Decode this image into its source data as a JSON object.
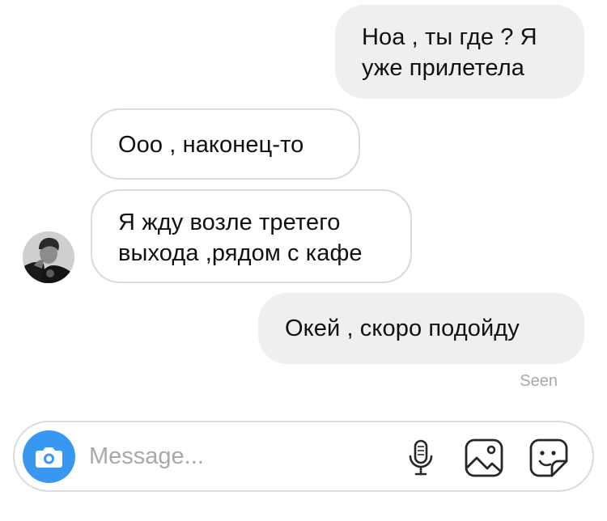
{
  "messages": [
    {
      "id": "msg1",
      "direction": "outgoing",
      "text": "Ноа , ты где ? Я\nуже прилетела"
    },
    {
      "id": "msg2",
      "direction": "incoming",
      "text": "Ооо , наконец-то"
    },
    {
      "id": "msg3",
      "direction": "incoming",
      "text": "Я жду возле третего\nвыхода ,рядом с кафе"
    },
    {
      "id": "msg4",
      "direction": "outgoing",
      "text": "Окей , скоро подойду"
    }
  ],
  "status": {
    "seen": "Seen"
  },
  "composer": {
    "placeholder": "Message...",
    "value": ""
  },
  "icons": {
    "avatar": "profile-photo",
    "camera": "camera-icon",
    "microphone": "microphone-icon",
    "gallery": "image-gallery-icon",
    "sticker": "sticker-icon"
  },
  "colors": {
    "accent": "#3897f0",
    "outgoing_bubble": "#efefef",
    "incoming_border": "#dbdbdb",
    "muted_text": "#a8a8a8"
  }
}
